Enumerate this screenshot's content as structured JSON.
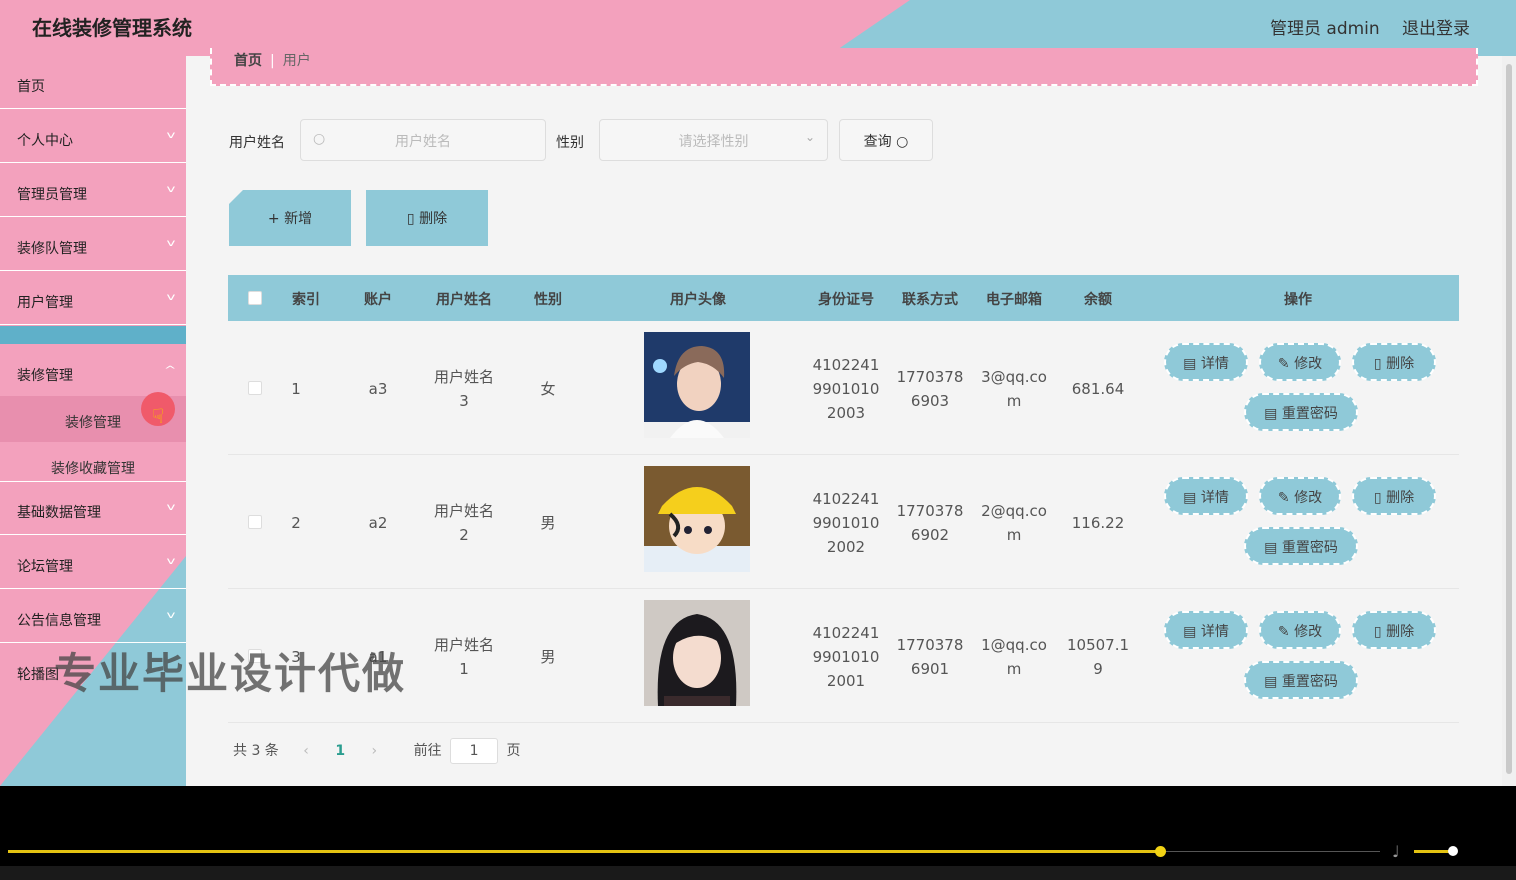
{
  "header": {
    "title": "在线装修管理系统",
    "user": "管理员 admin",
    "logout": "退出登录"
  },
  "sidebar": {
    "items": [
      {
        "label": "首页"
      },
      {
        "label": "个人中心"
      },
      {
        "label": "管理员管理"
      },
      {
        "label": "装修队管理"
      },
      {
        "label": "用户管理"
      },
      {
        "label": "装修管理"
      },
      {
        "label": "基础数据管理"
      },
      {
        "label": "论坛管理"
      },
      {
        "label": "公告信息管理"
      },
      {
        "label": "轮播图"
      }
    ],
    "sub_items": [
      {
        "label": "装修管理"
      },
      {
        "label": "装修收藏管理"
      }
    ]
  },
  "breadcrumb": {
    "home": "首页",
    "current": "用户"
  },
  "search": {
    "name_label": "用户姓名",
    "name_placeholder": "用户姓名",
    "gender_label": "性别",
    "gender_placeholder": "请选择性别",
    "query_label": "查询"
  },
  "actions": {
    "add": "新增",
    "delete": "删除"
  },
  "table": {
    "columns": [
      "索引",
      "账户",
      "用户姓名",
      "性别",
      "用户头像",
      "身份证号",
      "联系方式",
      "电子邮箱",
      "余额",
      "操作"
    ],
    "rows": [
      {
        "index": "1",
        "account": "a3",
        "name_l1": "用户姓名",
        "name_l2": "3",
        "gender": "女",
        "id_l1": "4102241",
        "id_l2": "9901010",
        "id_l3": "2003",
        "phone_l1": "1770378",
        "phone_l2": "6903",
        "email_l1": "3@qq.co",
        "email_l2": "m",
        "balance_l1": "681.64",
        "balance_l2": ""
      },
      {
        "index": "2",
        "account": "a2",
        "name_l1": "用户姓名",
        "name_l2": "2",
        "gender": "男",
        "id_l1": "4102241",
        "id_l2": "9901010",
        "id_l3": "2002",
        "phone_l1": "1770378",
        "phone_l2": "6902",
        "email_l1": "2@qq.co",
        "email_l2": "m",
        "balance_l1": "116.22",
        "balance_l2": ""
      },
      {
        "index": "3",
        "account": "a1",
        "name_l1": "用户姓名",
        "name_l2": "1",
        "gender": "男",
        "id_l1": "4102241",
        "id_l2": "9901010",
        "id_l3": "2001",
        "phone_l1": "1770378",
        "phone_l2": "6901",
        "email_l1": "1@qq.co",
        "email_l2": "m",
        "balance_l1": "10507.1",
        "balance_l2": "9"
      }
    ],
    "ops": {
      "detail": "详情",
      "edit": "修改",
      "delete": "删除",
      "reset": "重置密码"
    }
  },
  "pager": {
    "total": "共 3 条",
    "page": "1",
    "goto_prefix": "前往",
    "goto_value": "1",
    "goto_suffix": "页"
  },
  "watermark": "专业毕业设计代做",
  "colors": {
    "pink": "#f3a1bd",
    "blue": "#8fc9d8"
  }
}
